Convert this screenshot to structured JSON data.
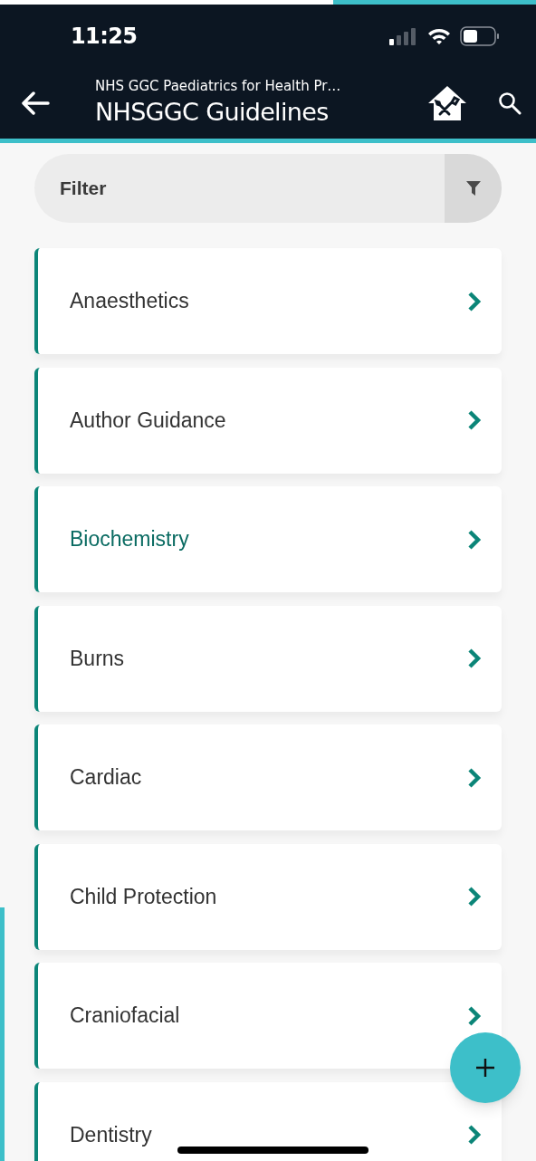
{
  "status_bar": {
    "time": "11:25"
  },
  "header": {
    "subtitle": "NHS GGC Paediatrics for Health Pr…",
    "title": "NHSGGC Guidelines"
  },
  "filter": {
    "placeholder": "Filter"
  },
  "categories": [
    {
      "label": "Anaesthetics",
      "selected": false
    },
    {
      "label": "Author Guidance",
      "selected": false
    },
    {
      "label": "Biochemistry",
      "selected": true
    },
    {
      "label": "Burns",
      "selected": false
    },
    {
      "label": "Cardiac",
      "selected": false
    },
    {
      "label": "Child Protection",
      "selected": false
    },
    {
      "label": "Craniofacial",
      "selected": false
    },
    {
      "label": "Dentistry",
      "selected": false
    }
  ]
}
